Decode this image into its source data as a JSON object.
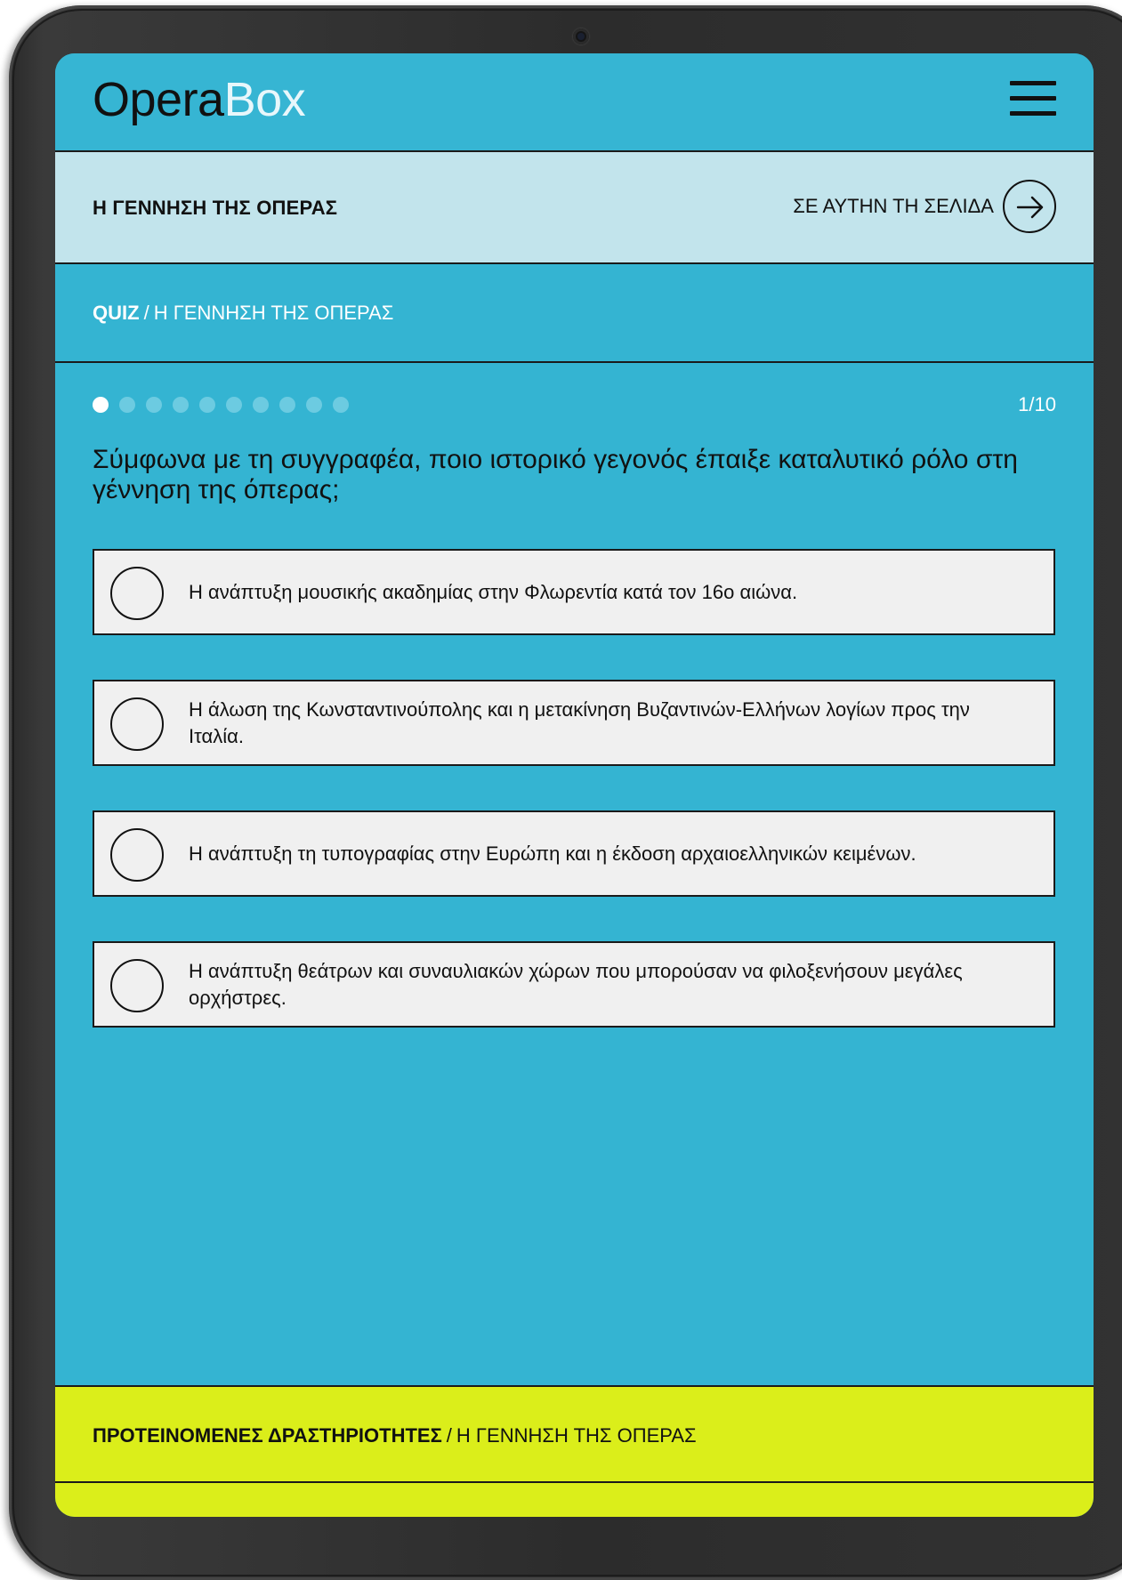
{
  "header": {
    "logo_part1": "Opera",
    "logo_part2": "Box",
    "menu_icon": "hamburger-menu-icon"
  },
  "section": {
    "title": "Η ΓΕΝΝΗΣΗ ΤΗΣ ΟΠΕΡΑΣ",
    "on_page_label": "ΣΕ ΑΥΤΗΝ ΤΗ ΣΕΛΙΔΑ",
    "on_page_icon": "arrow-right-circle-icon"
  },
  "breadcrumb": {
    "root": "QUIZ",
    "separator": "/",
    "current": "Η ΓΕΝΝΗΣΗ ΤΗΣ ΟΠΕΡΑΣ"
  },
  "quiz": {
    "total_steps": 10,
    "current_step": 1,
    "counter": "1/10",
    "question": "Σύμφωνα με τη συγγραφέα, ποιο ιστορικό γεγονός έπαιξε καταλυτικό ρόλο στη γέννηση της όπερας;",
    "options": [
      "Η ανάπτυξη μουσικής ακαδημίας στην Φλωρεντία κατά τον 16ο αιώνα.",
      "Η άλωση της Κωνσταντινούπολης και η μετακίνηση Βυζαντινών-Ελλήνων λογίων προς την Ιταλία.",
      "Η ανάπτυξη τη τυπογραφίας στην Ευρώπη και η έκδοση αρχαιοελληνικών κειμένων.",
      "Η ανάπτυξη θεάτρων και συναυλιακών χώρων που μπορούσαν να φιλοξενήσουν μεγάλες ορχήστρες."
    ]
  },
  "footer": {
    "root": "ΠΡΟΤΕΙΝΟΜΕΝΕΣ ΔΡΑΣΤΗΡΙΟΤΗΤΕΣ",
    "separator": "/",
    "current": "Η ΓΕΝΝΗΣΗ ΤΗΣ ΟΠΕΡΑΣ"
  },
  "colors": {
    "primary_blue": "#34b4d2",
    "section_light_blue": "#c2e4ec",
    "footer_lime": "#dbee1a",
    "option_bg": "#f0f0f0"
  }
}
